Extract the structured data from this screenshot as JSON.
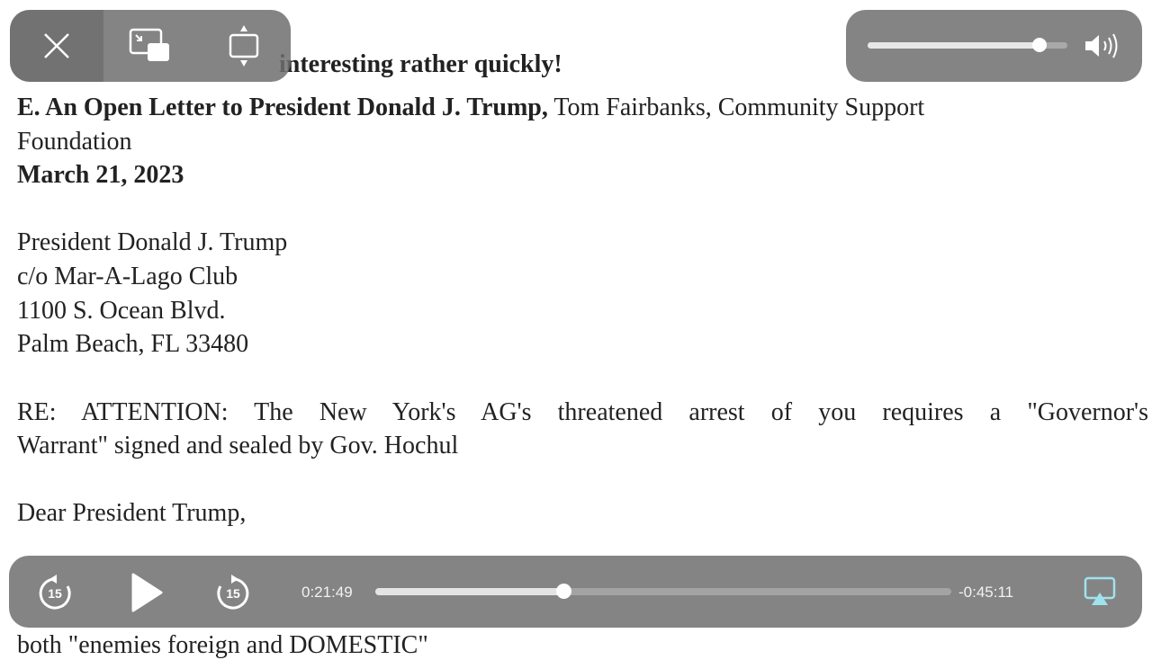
{
  "document": {
    "partial_top_line": "interesting rather quickly!",
    "heading_bold": "E. An Open Letter to President Donald J. Trump,",
    "heading_rest": " Tom Fairbanks, Community Support",
    "heading_cont": "Foundation",
    "date": "March 21, 2023",
    "address": [
      "President Donald J. Trump",
      "c/o Mar-A-Lago Club",
      "1100 S. Ocean Blvd.",
      "Palm Beach, FL  33480"
    ],
    "re_line1": "RE: ATTENTION: The New York's AG's threatened arrest of you requires a \"Governor's",
    "re_line2": "Warrant\" signed and sealed by Gov. Hochul",
    "salutation": "Dear President Trump,",
    "partial_bottom_line": "both \"enemies foreign and DOMESTIC\""
  },
  "player": {
    "elapsed": "0:21:49",
    "remaining": "-0:45:11",
    "progress_fraction": 0.326,
    "volume_fraction": 0.86,
    "skip_back_seconds": "15",
    "skip_forward_seconds": "15",
    "airplay_color": "#9fe3ee",
    "icons": [
      "close-icon",
      "picture-in-picture-icon",
      "resize-icon",
      "speaker-icon",
      "skip-back-15-icon",
      "play-icon",
      "skip-forward-15-icon",
      "airplay-icon"
    ]
  }
}
